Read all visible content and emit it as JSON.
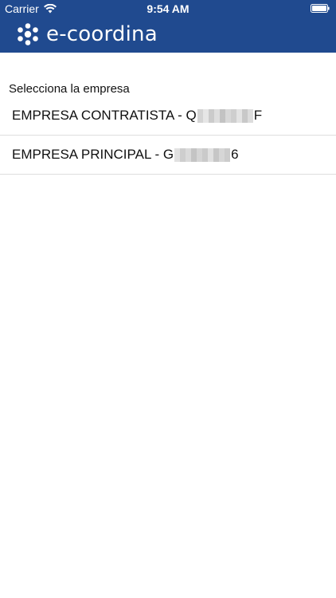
{
  "status_bar": {
    "carrier": "Carrier",
    "time": "9:54 AM",
    "icons": [
      "wifi-icon",
      "battery-icon"
    ]
  },
  "app_bar": {
    "brand_name": "e-coordina",
    "logo_icon": "molecule-logo-icon",
    "background_color": "#204a8f"
  },
  "company_selector": {
    "label": "Selecciona la empresa",
    "items": [
      {
        "prefix": "EMPRESA CONTRATISTA - Q",
        "suffix": "F"
      },
      {
        "prefix": "EMPRESA PRINCIPAL - G",
        "suffix": "6"
      }
    ]
  }
}
